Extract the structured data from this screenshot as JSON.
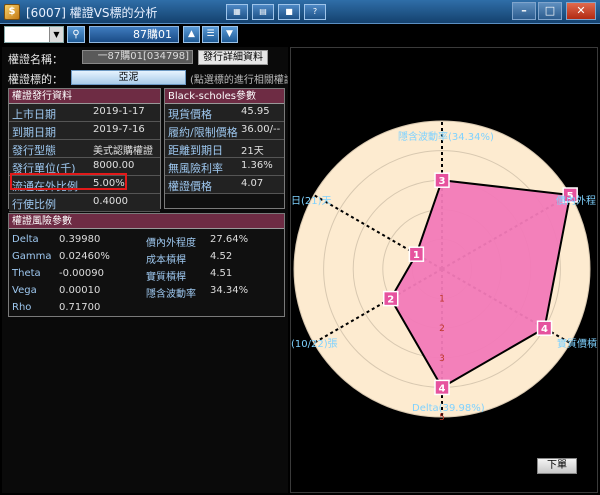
{
  "window": {
    "title": "[6007] 權證VS標的分析",
    "icons": [
      "tile-icon",
      "chart-icon",
      "record-icon",
      "help-icon"
    ],
    "controls": {
      "minimize": "–",
      "maximize": "□",
      "close": "✕"
    }
  },
  "toolbar": {
    "combo_value": "",
    "code_value": "87購01",
    "nav_up": "▲",
    "list_icon": "list-icon",
    "nav_down": "▼"
  },
  "warrant": {
    "name_label": "權證名稱：",
    "name_value": "一87購01[034798]",
    "issue_button": "發行詳細資料",
    "underlying_label": "權證標的：",
    "underlying_value": "亞泥",
    "hint": "(點選標的進行相關權證"
  },
  "issue_info": {
    "title": "權證發行資料",
    "rows": [
      {
        "k": "上市日期",
        "v": "2019-1-17"
      },
      {
        "k": "到期日期",
        "v": "2019-7-16"
      },
      {
        "k": "發行型態",
        "v": "美式認購權證"
      },
      {
        "k": "發行單位(千)",
        "v": "8000.00"
      },
      {
        "k": "流通在外比例",
        "v": "5.00%"
      },
      {
        "k": "行使比例",
        "v": "0.4000"
      }
    ]
  },
  "bs_params": {
    "title": "Black-scholes參數",
    "rows": [
      {
        "k": "現貨價格",
        "v": "45.95"
      },
      {
        "k": "履約/限制價格",
        "v": "36.00/--"
      },
      {
        "k": "距離到期日",
        "v": "21天"
      },
      {
        "k": "無風險利率",
        "v": "1.36%"
      },
      {
        "k": "權證價格",
        "v": "4.07"
      }
    ]
  },
  "risk": {
    "title": "權證風險參數",
    "rows": [
      {
        "k1": "Delta",
        "v1": "0.39980",
        "k2": "價內外程度",
        "v2": "27.64%"
      },
      {
        "k1": "Gamma",
        "v1": "0.02460%",
        "k2": "成本槓桿",
        "v2": "4.52"
      },
      {
        "k1": "Theta",
        "v1": "-0.00090",
        "k2": "實質槓桿",
        "v2": "4.51"
      },
      {
        "k1": "Vega",
        "v1": "0.00010",
        "k2": "隱含波動率",
        "v2": "34.34%"
      },
      {
        "k1": "Rho",
        "v1": "0.71700",
        "k2": "",
        "v2": ""
      }
    ]
  },
  "radar": {
    "labels": {
      "top": "隱含波動率(34.34%)",
      "right_top": "價內外程",
      "right_bottom": "實質價槓",
      "bottom": "Delta(39.98%)",
      "left_bottom": "(10/22)張",
      "left_top": "日(21)天"
    },
    "scale_labels": [
      "1",
      "2",
      "3",
      "4",
      "5"
    ],
    "values": [
      3,
      5,
      4,
      4,
      2,
      1
    ],
    "colors": {
      "fill": "#f27ab8",
      "background": "#fdebd0",
      "marker": "#e6529e",
      "axis": "#7fd2ff"
    }
  },
  "bottom_button": "下單"
}
